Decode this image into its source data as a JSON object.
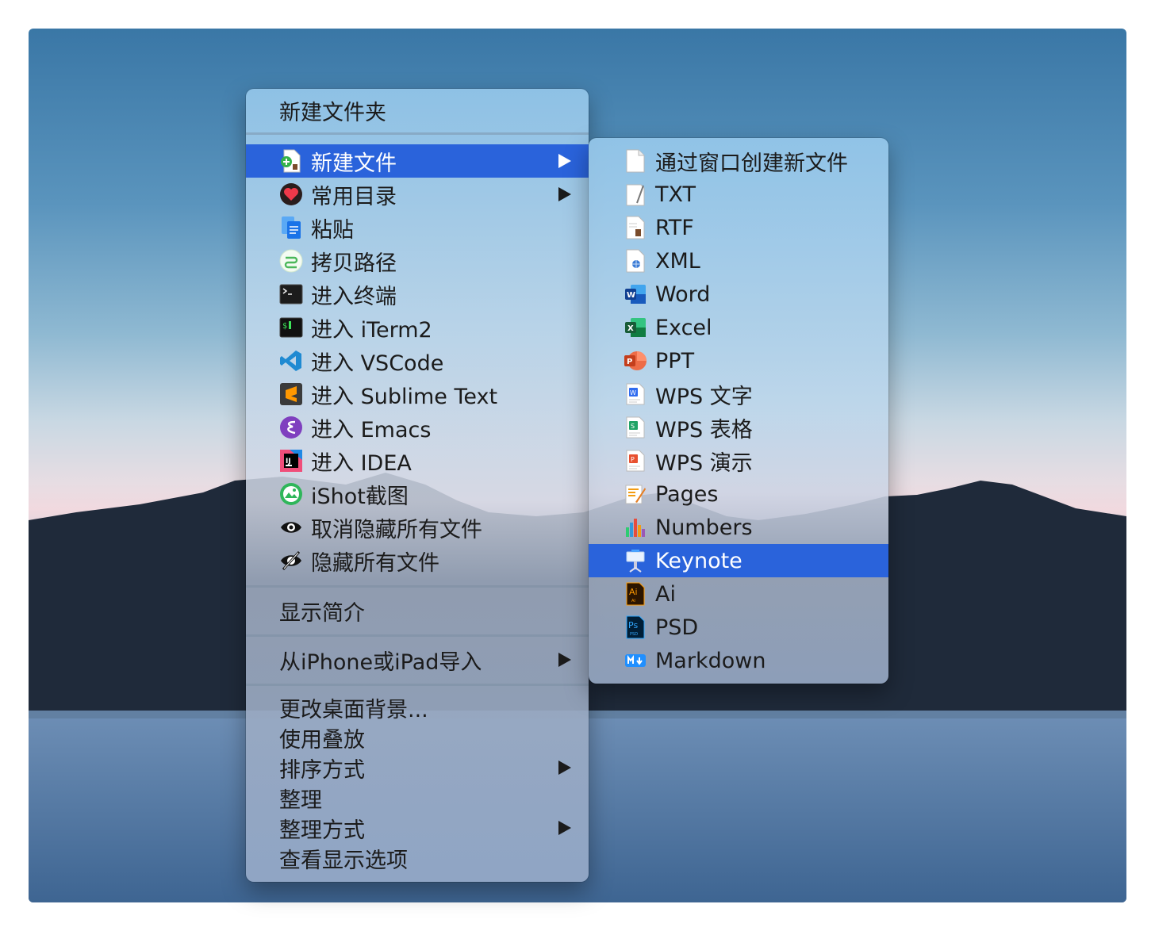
{
  "main_menu": {
    "top_item": "新建文件夹",
    "items": [
      {
        "label": "新建文件",
        "icon": "new-file-icon",
        "submenu": true,
        "selected": true
      },
      {
        "label": "常用目录",
        "icon": "heart-icon",
        "submenu": true
      },
      {
        "label": "粘贴",
        "icon": "paste-icon"
      },
      {
        "label": "拷贝路径",
        "icon": "copy-path-icon"
      },
      {
        "label": "进入终端",
        "icon": "terminal-icon"
      },
      {
        "label": "进入 iTerm2",
        "icon": "iterm2-icon"
      },
      {
        "label": "进入 VSCode",
        "icon": "vscode-icon"
      },
      {
        "label": "进入 Sublime Text",
        "icon": "sublime-icon"
      },
      {
        "label": "进入 Emacs",
        "icon": "emacs-icon"
      },
      {
        "label": "进入 IDEA",
        "icon": "idea-icon"
      },
      {
        "label": "iShot截图",
        "icon": "ishot-icon"
      },
      {
        "label": "取消隐藏所有文件",
        "icon": "eye-icon"
      },
      {
        "label": "隐藏所有文件",
        "icon": "eye-slash-icon"
      }
    ],
    "info_item": "显示简介",
    "import_item": "从iPhone或iPad导入",
    "bottom_items": [
      {
        "label": "更改桌面背景...",
        "submenu": false
      },
      {
        "label": "使用叠放",
        "submenu": false
      },
      {
        "label": "排序方式",
        "submenu": true
      },
      {
        "label": "整理",
        "submenu": false
      },
      {
        "label": "整理方式",
        "submenu": true
      },
      {
        "label": "查看显示选项",
        "submenu": false
      }
    ]
  },
  "sub_menu": {
    "items": [
      {
        "label": "通过窗口创建新文件",
        "icon": "blank-doc-icon"
      },
      {
        "label": "TXT",
        "icon": "txt-icon"
      },
      {
        "label": "RTF",
        "icon": "rtf-icon"
      },
      {
        "label": "XML",
        "icon": "xml-icon"
      },
      {
        "label": "Word",
        "icon": "word-icon"
      },
      {
        "label": "Excel",
        "icon": "excel-icon"
      },
      {
        "label": "PPT",
        "icon": "ppt-icon"
      },
      {
        "label": "WPS 文字",
        "icon": "wps-writer-icon"
      },
      {
        "label": "WPS 表格",
        "icon": "wps-sheet-icon"
      },
      {
        "label": "WPS 演示",
        "icon": "wps-slide-icon"
      },
      {
        "label": "Pages",
        "icon": "pages-icon"
      },
      {
        "label": "Numbers",
        "icon": "numbers-icon"
      },
      {
        "label": "Keynote",
        "icon": "keynote-icon",
        "selected": true
      },
      {
        "label": "Ai",
        "icon": "ai-icon"
      },
      {
        "label": "PSD",
        "icon": "psd-icon"
      },
      {
        "label": "Markdown",
        "icon": "markdown-icon"
      }
    ]
  },
  "colors": {
    "selection": "#2a63db",
    "text": "#1b1b1b"
  }
}
